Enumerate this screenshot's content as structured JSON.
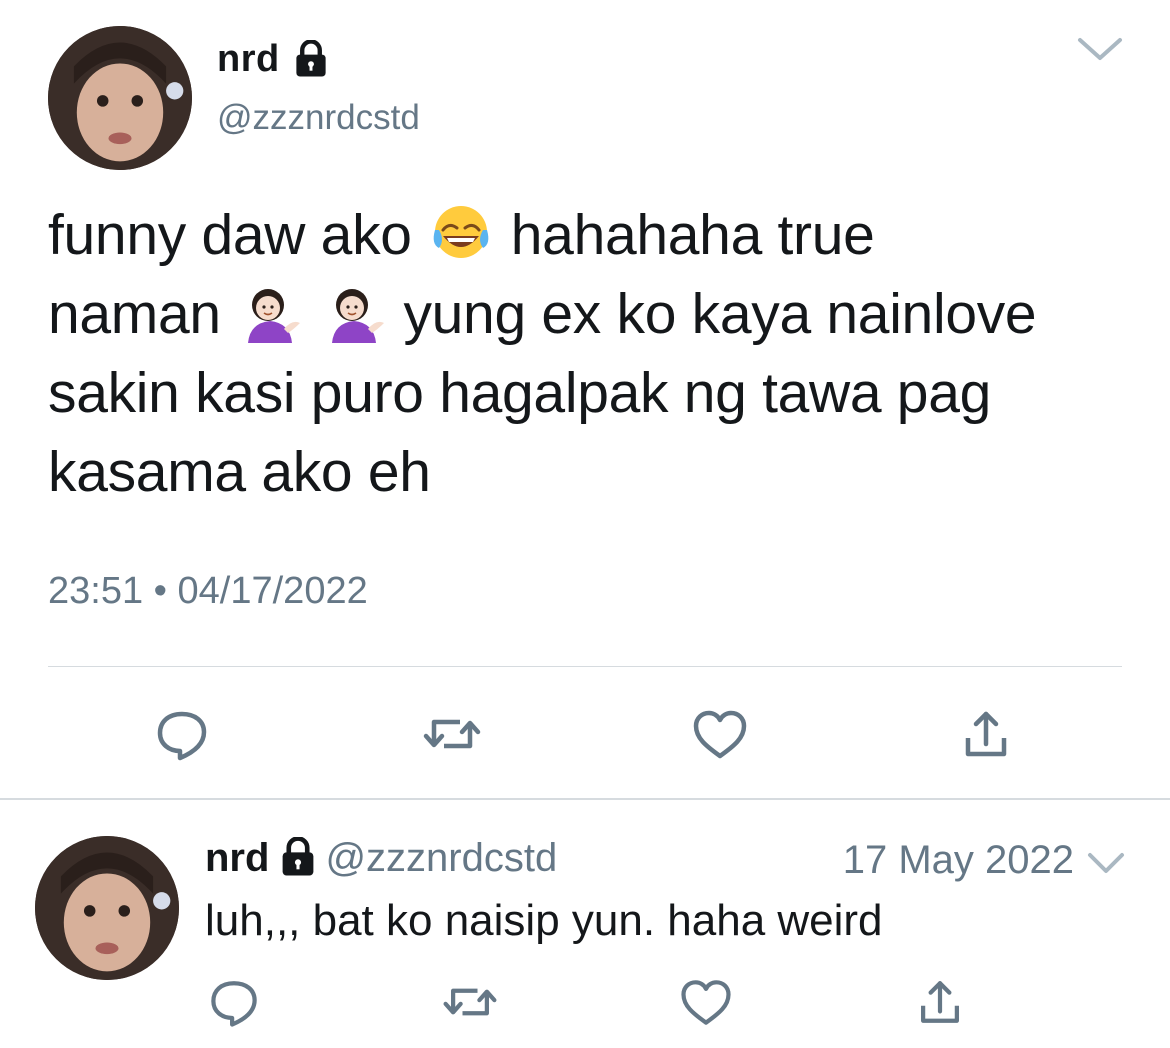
{
  "tweet": {
    "author_name": "nrd",
    "author_handle": "@zzznrdcstd",
    "author_locked": true,
    "text_lines": [
      [
        "funny daw ako",
        "hahahaha true"
      ],
      [
        "naman",
        "yung ex ko kaya nainlove"
      ],
      [
        "sakin kasi puro hagalpak ng tawa pag"
      ],
      [
        "kasama ako eh"
      ]
    ],
    "emojis": [
      "face-with-tears-of-joy",
      "information-desk-person",
      "information-desk-person"
    ],
    "time": "23:51",
    "separator": "•",
    "date": "04/17/2022",
    "actions": [
      "reply",
      "retweet",
      "like",
      "share"
    ]
  },
  "reply": {
    "author_name": "nrd",
    "author_handle": "@zzznrdcstd",
    "author_locked": true,
    "date": "17 May 2022",
    "text": "luh,,, bat ko naisip yun. haha weird",
    "actions": [
      "reply",
      "retweet",
      "like",
      "share"
    ]
  },
  "colors": {
    "text": "#14171a",
    "secondary": "#657786",
    "icon": "#657786",
    "divider": "#d6dbdf",
    "background": "#ffffff"
  }
}
